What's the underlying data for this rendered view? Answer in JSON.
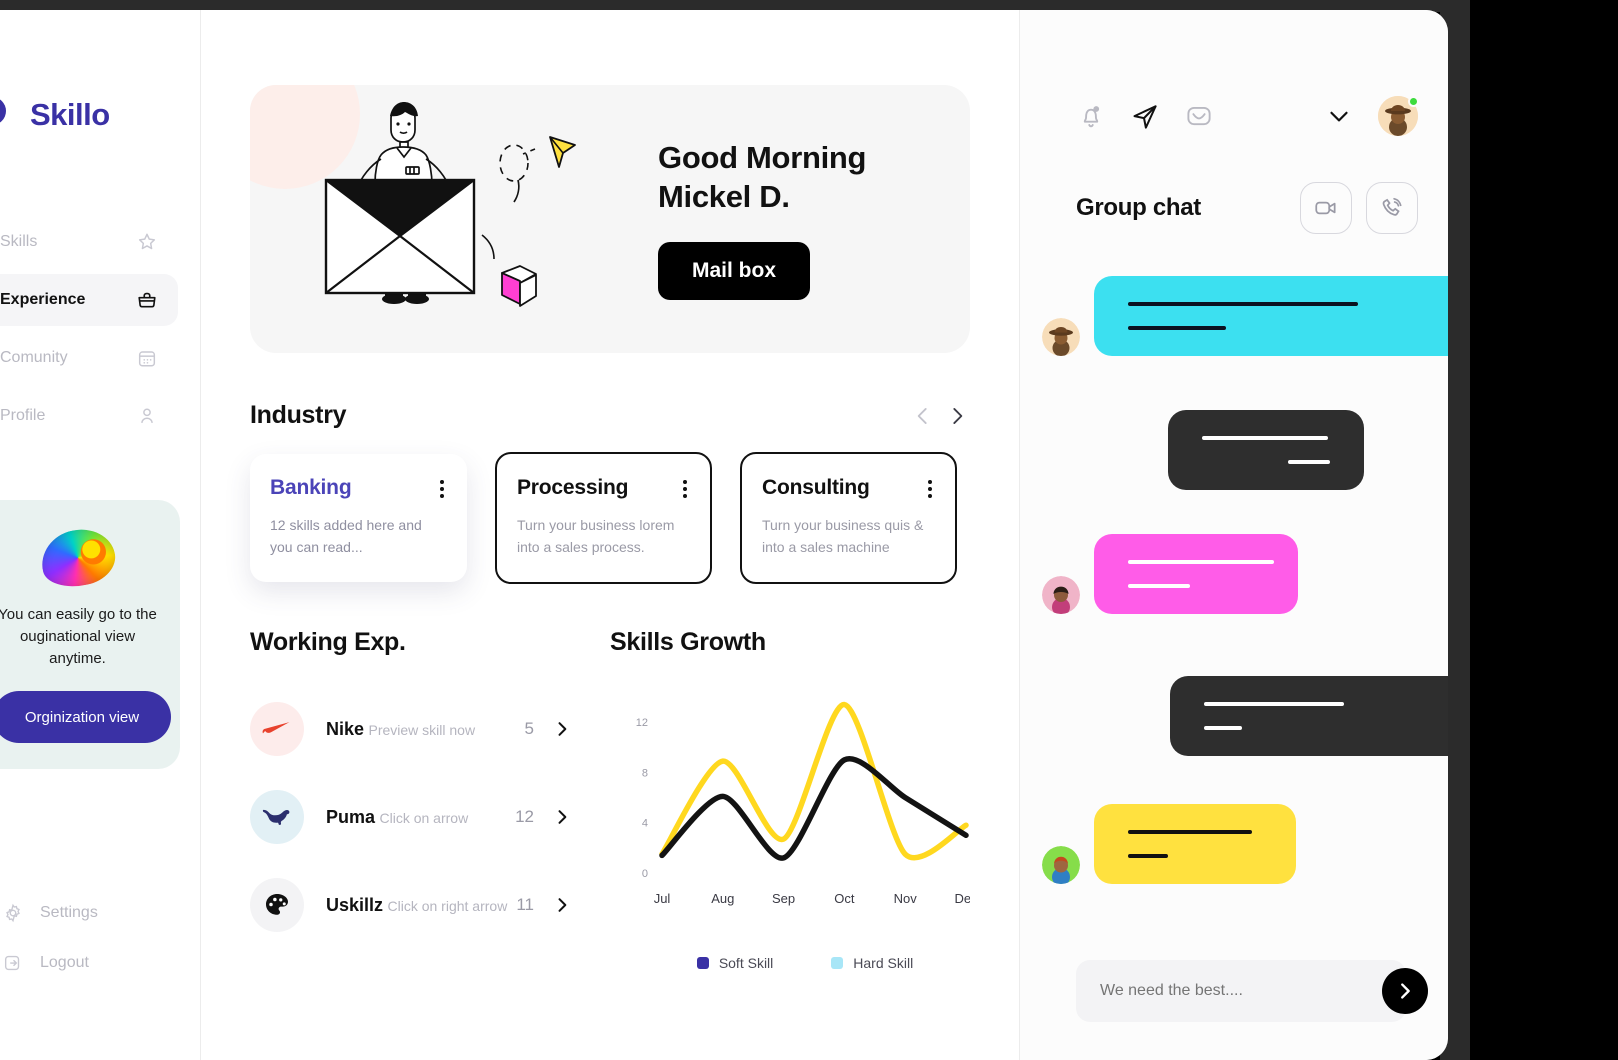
{
  "brand": {
    "name": "Skillo",
    "accent": "#3a31a5"
  },
  "sidebar": {
    "items": [
      {
        "label": "Skills",
        "icon": "star-icon",
        "active": false
      },
      {
        "label": "Experience",
        "icon": "briefcase-icon",
        "active": true
      },
      {
        "label": "Comunity",
        "icon": "calendar-icon",
        "active": false
      },
      {
        "label": "Profile",
        "icon": "user-icon",
        "active": false
      }
    ],
    "promo": {
      "text": "You can easily go to the ouginational view anytime.",
      "button_label": "Orginization view"
    },
    "footer": [
      {
        "label": "Settings",
        "icon": "gear-icon"
      },
      {
        "label": "Logout",
        "icon": "logout-icon"
      }
    ]
  },
  "hero": {
    "greeting_line1": "Good Morning",
    "greeting_line2": "Mickel D.",
    "button_label": "Mail box"
  },
  "industry": {
    "title": "Industry",
    "cards": [
      {
        "name": "Banking",
        "desc": "12 skills added here and you can read...",
        "style": "soft"
      },
      {
        "name": "Processing",
        "desc": "Turn your business lorem into a sales process.",
        "style": "outlined"
      },
      {
        "name": "Consulting",
        "desc": "Turn your business quis & into a sales machine",
        "style": "outlined"
      }
    ]
  },
  "working_exp": {
    "title": "Working Exp.",
    "rows": [
      {
        "name": "Nike",
        "sub": "Preview skill now",
        "count": "5",
        "logo": "nike-logo",
        "bg": "#fdeceb"
      },
      {
        "name": "Puma",
        "sub": "Click on arrow",
        "count": "12",
        "logo": "puma-logo",
        "bg": "#e2f0f5"
      },
      {
        "name": "Uskillz",
        "sub": "Click on right arrow",
        "count": "11",
        "logo": "palette-logo",
        "bg": "#f3f3f5"
      }
    ]
  },
  "chart_data": {
    "type": "line",
    "title": "Skills Growth",
    "xlabel": "",
    "ylabel": "",
    "categories": [
      "Jul",
      "Aug",
      "Sep",
      "Oct",
      "Nov",
      "Dec"
    ],
    "yticks": [
      0,
      4,
      8,
      12
    ],
    "ylim": [
      0,
      14
    ],
    "grid": false,
    "legend_position": "bottom",
    "series": [
      {
        "name": "Soft Skill",
        "color": "#131313",
        "legend_color": "#3a31a5",
        "values": [
          1.4,
          6.1,
          1.2,
          9.0,
          6.0,
          3.0
        ]
      },
      {
        "name": "Hard Skill",
        "color": "#ffd81f",
        "legend_color": "#a8e6f7",
        "values": [
          1.5,
          8.9,
          2.7,
          13.4,
          1.5,
          3.8
        ]
      }
    ]
  },
  "chat": {
    "title": "Group chat",
    "topbar_icons": [
      "bell-icon",
      "paper-plane-icon",
      "envelope-icon",
      "chevron-down-icon"
    ],
    "action_icons": [
      "video-camera-icon",
      "phone-icon"
    ],
    "messages": [
      {
        "side": "left",
        "color": "#3ce0f0",
        "bar_color": "#0b1220",
        "bars": [
          230,
          98
        ],
        "avatar": "avatar-hat"
      },
      {
        "side": "right",
        "color": "#2e2e2e",
        "bar_color": "#ffffff",
        "bars": [
          126,
          42
        ],
        "avatar": ""
      },
      {
        "side": "left",
        "color": "#ff5ce8",
        "bar_color": "#ffffff",
        "bars": [
          146,
          62
        ],
        "avatar": "avatar-pink"
      },
      {
        "side": "right",
        "color": "#2e2e2e",
        "bar_color": "#ffffff",
        "bars": [
          140,
          38
        ],
        "avatar": ""
      },
      {
        "side": "left",
        "color": "#ffe13f",
        "bar_color": "#111111",
        "bars": [
          124,
          40
        ],
        "avatar": "avatar-green"
      }
    ],
    "input": {
      "placeholder": "We need the best....",
      "value": ""
    },
    "send_icon": "chevron-right-icon"
  }
}
